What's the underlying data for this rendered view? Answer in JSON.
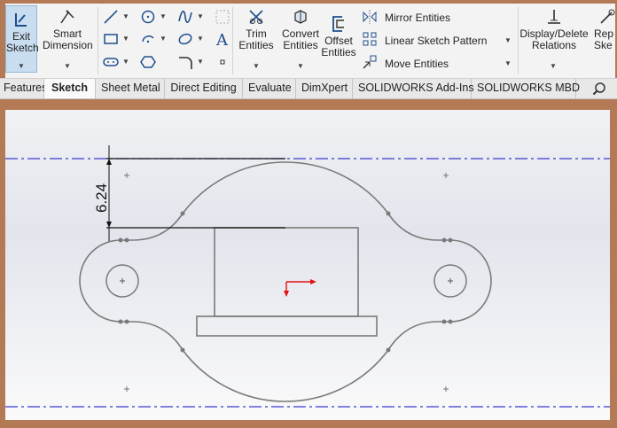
{
  "ribbon": {
    "exit_sketch": "Exit Sketch",
    "smart_dimension": "Smart Dimension",
    "trim_entities": "Trim Entities",
    "convert_entities": "Convert Entities",
    "offset_entities": "Offset Entities",
    "mirror_entities": "Mirror Entities",
    "linear_sketch_pattern": "Linear Sketch Pattern",
    "move_entities": "Move Entities",
    "display_delete_relations": "Display/Delete Relations",
    "repair_sketch_partial": "Rep Ske"
  },
  "tabs": [
    {
      "label": "Features"
    },
    {
      "label": "Sketch"
    },
    {
      "label": "Sheet Metal"
    },
    {
      "label": "Direct Editing"
    },
    {
      "label": "Evaluate"
    },
    {
      "label": "DimXpert"
    },
    {
      "label": "SOLIDWORKS Add-Ins"
    },
    {
      "label": "SOLIDWORKS MBD"
    }
  ],
  "active_tab": "Sketch",
  "sketch": {
    "dimension_value": "6.24"
  },
  "colors": {
    "ribbon_bg": "#f3f3f3",
    "frame": "#b47a55",
    "centerline": "#3a3ad0",
    "origin": "#e01010",
    "sketch_line": "#7a7a7a"
  }
}
